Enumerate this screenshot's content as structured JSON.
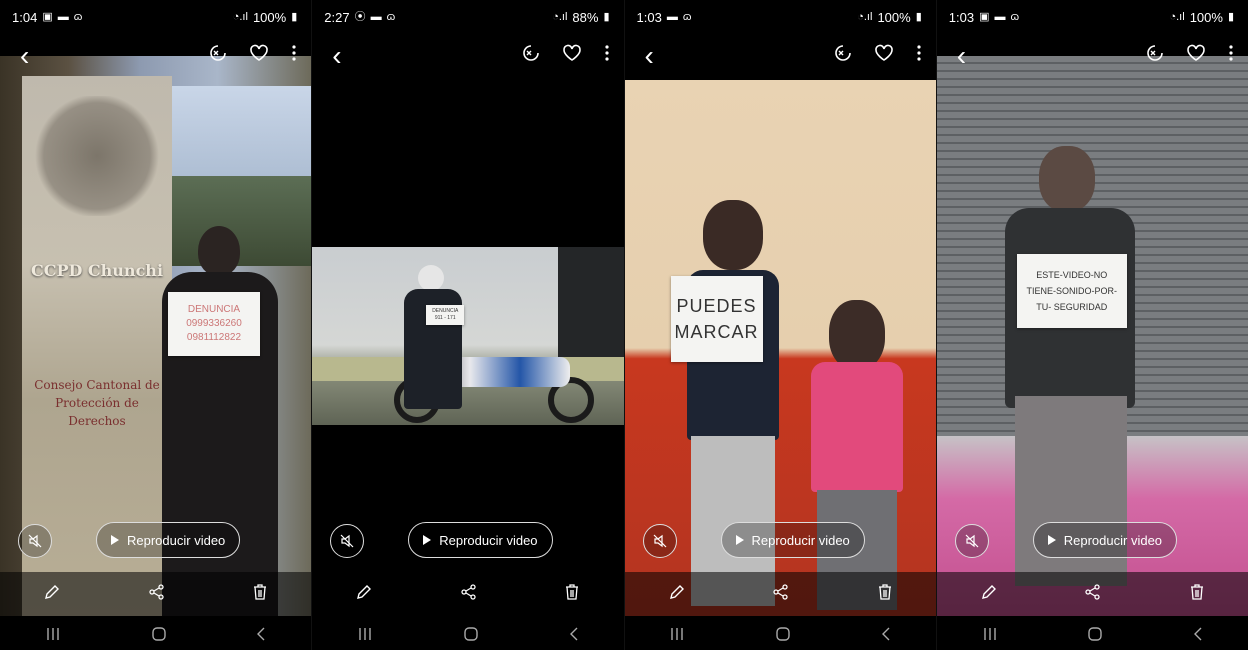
{
  "common": {
    "play_label": "Reproducir video",
    "icons": {
      "back": "chevron-left-icon",
      "rotate": "rotate-icon",
      "favorite": "heart-icon",
      "more": "more-vert-icon",
      "mute": "mute-icon",
      "edit": "pencil-icon",
      "share": "share-icon",
      "delete": "trash-icon",
      "nav_recents": "recents-icon",
      "nav_home": "home-icon",
      "nav_back": "nav-back-icon"
    }
  },
  "phones": [
    {
      "time": "1:04",
      "battery": "100%",
      "banner_title": "CCPD Chunchi",
      "banner_text": "Consejo Cantonal de Protección de Derechos",
      "sign_lines": [
        "DENUNCIA",
        "0999336260",
        "0981112822"
      ]
    },
    {
      "time": "2:27",
      "battery": "88%",
      "sign_lines": [
        "DENUNCIA",
        "911 - 171"
      ]
    },
    {
      "time": "1:03",
      "battery": "100%",
      "sign_lines": [
        "PUEDES",
        "MARCAR"
      ]
    },
    {
      "time": "1:03",
      "battery": "100%",
      "sign_lines": [
        "ESTE-VIDEO-NO",
        "TIENE-SONIDO-POR-",
        "TU- SEGURIDAD"
      ]
    }
  ]
}
